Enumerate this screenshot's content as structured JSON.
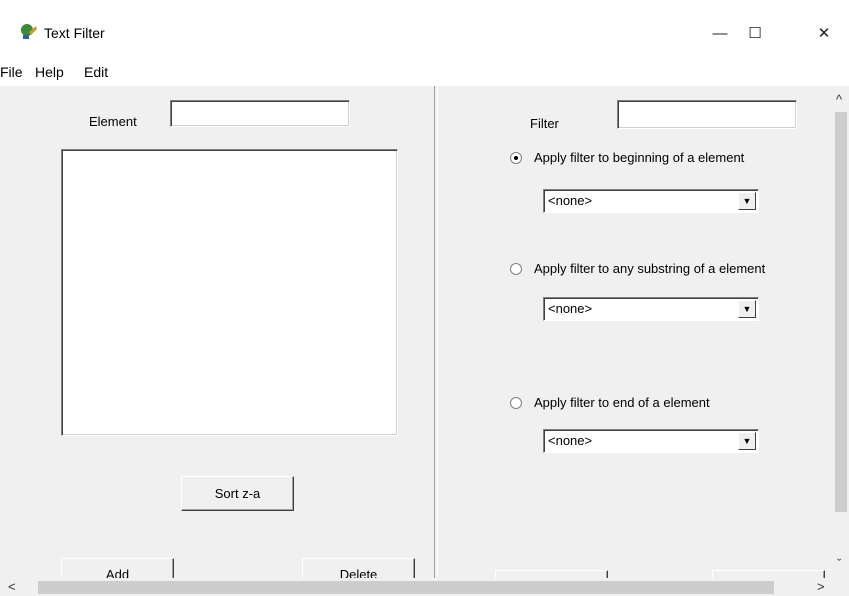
{
  "window": {
    "title": "Text Filter",
    "minimize_glyph": "—",
    "maximize_glyph": "☐",
    "close_glyph": "✕"
  },
  "menu": [
    "File",
    "Help",
    "Edit"
  ],
  "left": {
    "element_label": "Element",
    "element_value": "",
    "sort_label": "Sort z-a",
    "add_label": "Add",
    "delete_label": "Delete"
  },
  "right": {
    "filter_label": "Filter",
    "filter_value": "",
    "options": [
      {
        "label": "Apply filter to beginning of a element",
        "selected": true,
        "dropdown": "<none>"
      },
      {
        "label": "Apply filter to any substring of a element",
        "selected": false,
        "dropdown": "<none>"
      },
      {
        "label": "Apply filter to end of a element",
        "selected": false,
        "dropdown": "<none>"
      }
    ]
  },
  "scroll": {
    "up": "^",
    "down": "ˇ",
    "left": "<",
    "right": ">"
  },
  "icons": {
    "app": "app-icon",
    "dropdown": "chevron-down-icon"
  }
}
